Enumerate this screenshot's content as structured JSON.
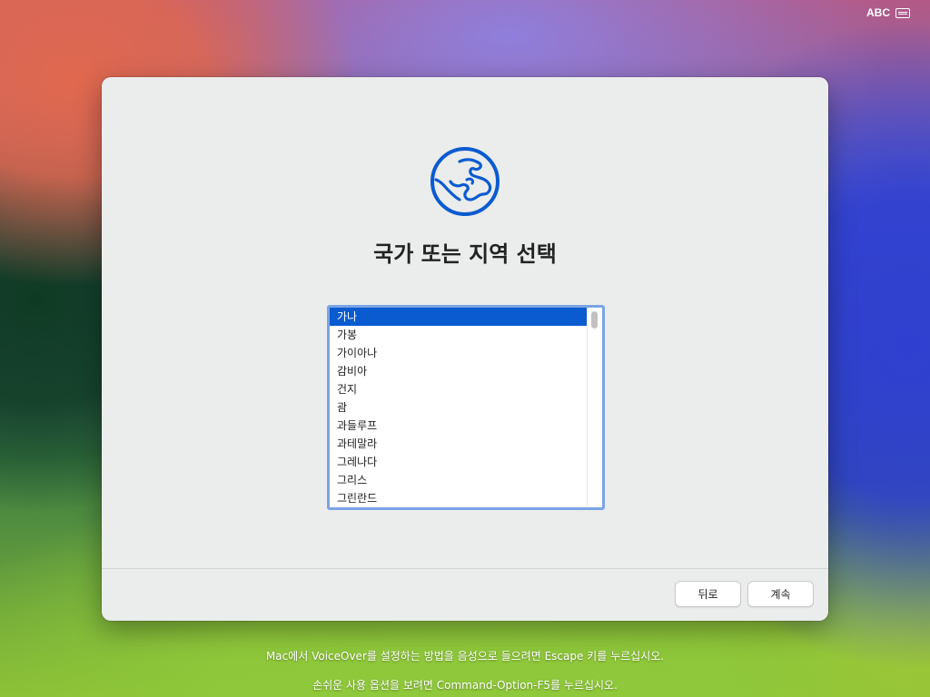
{
  "menubar": {
    "input_source": "ABC",
    "input_icon": "keyboard-icon"
  },
  "setup": {
    "icon": "globe-icon",
    "title": "국가 또는 지역 선택",
    "accent_color": "#0a5bd0",
    "countries": [
      {
        "label": "가나",
        "selected": true
      },
      {
        "label": "가봉",
        "selected": false
      },
      {
        "label": "가이아나",
        "selected": false
      },
      {
        "label": "감비아",
        "selected": false
      },
      {
        "label": "건지",
        "selected": false
      },
      {
        "label": "괌",
        "selected": false
      },
      {
        "label": "과들루프",
        "selected": false
      },
      {
        "label": "과테말라",
        "selected": false
      },
      {
        "label": "그레나다",
        "selected": false
      },
      {
        "label": "그리스",
        "selected": false
      },
      {
        "label": "그린란드",
        "selected": false
      }
    ],
    "back_label": "뒤로",
    "continue_label": "계속"
  },
  "hints": {
    "voiceover": "Mac에서 VoiceOver를 설정하는 방법을 음성으로 들으려면 Escape 키를 누르십시오.",
    "accessibility": "손쉬운 사용 옵션을 보려면 Command-Option-F5를 누르십시오."
  }
}
